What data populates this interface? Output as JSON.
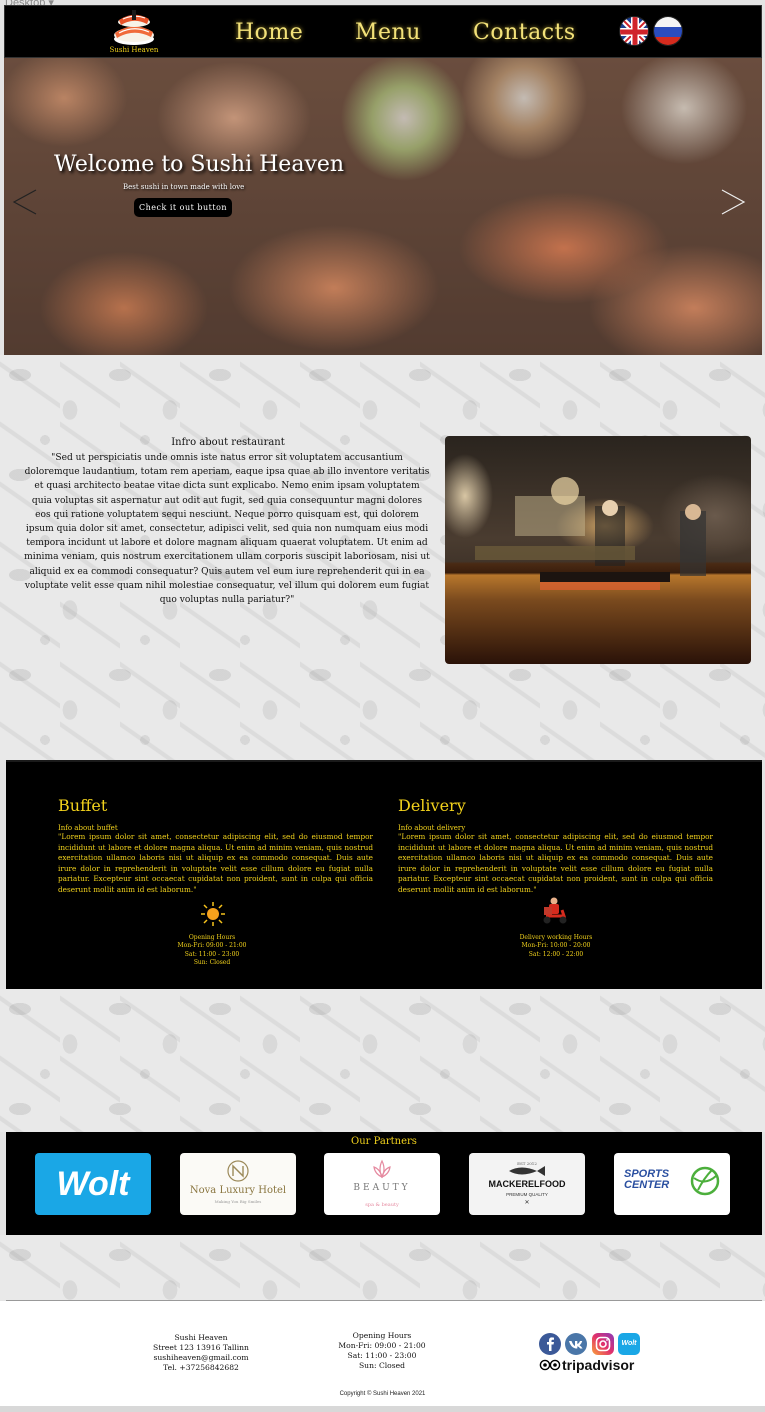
{
  "viewport_label": "Desktop",
  "brand": {
    "name": "Sushi Heaven"
  },
  "nav": {
    "home": "Home",
    "menu": "Menu",
    "contacts": "Contacts"
  },
  "hero": {
    "title": "Welcome to Sushi Heaven",
    "subtitle": "Best sushi in town made with love",
    "button": "Check it out button"
  },
  "info": {
    "title": "Infro about restaurant",
    "text": "\"Sed ut perspiciatis unde omnis iste natus error sit voluptatem accusantium doloremque laudantium, totam rem aperiam, eaque ipsa quae ab illo inventore veritatis et quasi architecto beatae vitae dicta sunt explicabo. Nemo enim ipsam voluptatem quia voluptas sit aspernatur aut odit aut fugit, sed quia consequuntur magni dolores eos qui ratione voluptatem sequi nesciunt. Neque porro quisquam est, qui dolorem ipsum quia dolor sit amet, consectetur, adipisci velit, sed quia non numquam eius modi tempora incidunt ut labore et dolore magnam aliquam quaerat voluptatem. Ut enim ad minima veniam, quis nostrum exercitationem ullam corporis suscipit laboriosam, nisi ut aliquid ex ea commodi consequatur? Quis autem vel eum iure reprehenderit qui in ea voluptate velit esse quam nihil molestiae consequatur, vel illum qui dolorem eum fugiat quo voluptas nulla pariatur?\""
  },
  "buffet": {
    "title": "Buffet",
    "subtitle": "Info about buffet",
    "text": "\"Lorem ipsum dolor sit amet, consectetur adipiscing elit, sed do eiusmod tempor incididunt ut labore et dolore magna aliqua. Ut enim ad minim veniam, quis nostrud exercitation ullamco laboris nisi ut aliquip ex ea commodo consequat. Duis aute irure dolor in reprehenderit in voluptate velit esse cillum dolore eu fugiat nulla pariatur. Excepteur sint occaecat cupidatat non proident, sunt in culpa qui officia deserunt mollit anim id est laborum.\"",
    "hours_title": "Opening Hours",
    "hours": [
      "Mon-Fri: 09:00 - 21:00",
      "Sat: 11:00 - 23:00",
      "Sun: Closed"
    ]
  },
  "delivery": {
    "title": "Delivery",
    "subtitle": "Info about delivery",
    "text": "\"Lorem ipsum dolor sit amet, consectetur adipiscing elit, sed do eiusmod tempor incididunt ut labore et dolore magna aliqua. Ut enim ad minim veniam, quis nostrud exercitation ullamco laboris nisi ut aliquip ex ea commodo consequat. Duis aute irure dolor in reprehenderit in voluptate velit esse cillum dolore eu fugiat nulla pariatur. Excepteur sint occaecat cupidatat non proident, sunt in culpa qui officia deserunt mollit anim id est laborum.\"",
    "hours_title": "Delivery working Hours",
    "hours": [
      "Mon-Fri: 10:00 - 20:00",
      "Sat: 12:00 - 22:00"
    ]
  },
  "partners": {
    "title": "Our Partners",
    "items": [
      {
        "name": "Wolt"
      },
      {
        "name": "Nova Luxury Hotel",
        "tagline": "Making You Big Smiles"
      },
      {
        "name": "BEAUTY",
        "tagline": "spa & beauty"
      },
      {
        "name": "MACKERELFOOD",
        "tagline": "PREMIUM QUALITY",
        "est": "EST 2012"
      },
      {
        "name": "SPORTS CENTER"
      }
    ]
  },
  "footer": {
    "company": "Sushi Heaven",
    "street": "Street 123 13916 Tallinn",
    "email": "sushiheaven@gmail.com",
    "phone": "Tel. +37256842682",
    "hours_title": "Opening Hours",
    "hours": [
      "Mon-Fri: 09:00 - 21:00",
      "Sat: 11:00 - 23:00",
      "Sun: Closed"
    ],
    "tripadvisor": "tripadvisor",
    "wolt_badge": "Wolt",
    "copyright": "Copyright © Sushi Heaven 2021"
  },
  "colors": {
    "accent": "#f2d21c",
    "nav": "#f3e279",
    "dark": "#000000"
  }
}
